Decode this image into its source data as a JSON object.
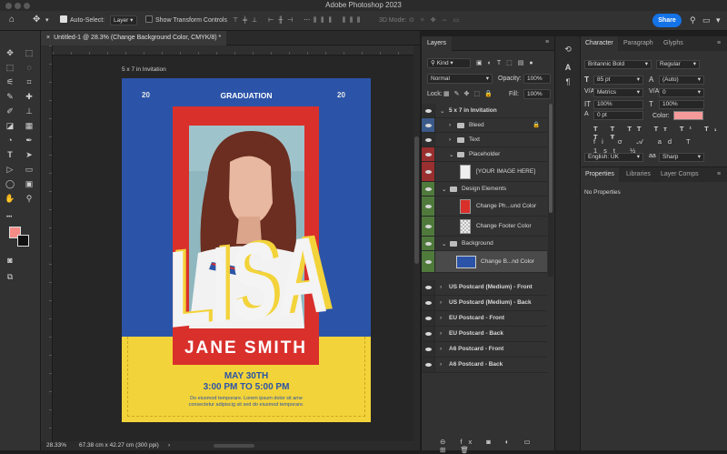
{
  "app_title": "Adobe Photoshop 2023",
  "options_bar": {
    "auto_select_label": "Auto-Select:",
    "auto_select_value": "Layer",
    "show_transform_label": "Show Transform Controls",
    "mode_3d_label": "3D Mode:",
    "share_label": "Share"
  },
  "document_tab": {
    "label": "Untitled-1 @ 28.3% (Change Background Color, CMYK/8) *"
  },
  "artboard_label": "5 x 7 in Invitation",
  "invitation": {
    "year_left": "20",
    "graduation": "GRADUATION",
    "year_right": "20",
    "big_name": "LISA",
    "full_name": "JANE SMITH",
    "date": "MAY 30TH",
    "time": "3:00 PM TO 5:00 PM",
    "body_line1": "Do eiusmod temporare. Lorem ipsum dolor sit ame",
    "body_line2": "consectetur adipiscig sit sed do eiusmod temporare."
  },
  "status_bar": {
    "zoom": "28.33%",
    "doc_info": "67.38 cm x 42.27 cm (300 ppi)"
  },
  "layers_panel": {
    "title": "Layers",
    "kind_label": "Kind",
    "blend_mode": "Normal",
    "opacity_label": "Opacity:",
    "opacity_value": "100%",
    "lock_label": "Lock:",
    "fill_label": "Fill:",
    "fill_value": "100%",
    "rows": [
      {
        "name": "5 x 7 in Invitation"
      },
      {
        "name": "Bleed"
      },
      {
        "name": "Text"
      },
      {
        "name": "Placeholder"
      },
      {
        "name": "[YOUR IMAGE HERE]"
      },
      {
        "name": "Design Elements"
      },
      {
        "name": "Change Ph...und Color"
      },
      {
        "name": "Change Footer Color"
      },
      {
        "name": "Background"
      },
      {
        "name": "Change B...nd Color"
      },
      {
        "name": "US Postcard (Medium) - Front"
      },
      {
        "name": "US Postcard (Medium) - Back"
      },
      {
        "name": "EU Postcard - Front"
      },
      {
        "name": "EU Postcard - Back"
      },
      {
        "name": "A6 Postcard - Front"
      },
      {
        "name": "A6 Postcard - Back"
      }
    ]
  },
  "character_panel": {
    "tabs": [
      "Character",
      "Paragraph",
      "Glyphs"
    ],
    "font_family": "Britannic Bold",
    "font_style": "Regular",
    "font_size": "85 pt",
    "leading": "(Auto)",
    "kerning": "Metrics",
    "tracking": "0",
    "vertical_scale": "100%",
    "horizontal_scale": "100%",
    "baseline_shift": "0 pt",
    "color_label": "Color:",
    "text_color": "#f59a9a",
    "language": "English: UK",
    "antialias": "Sharp"
  },
  "properties_panel": {
    "tabs": [
      "Properties",
      "Libraries",
      "Layer Comps"
    ],
    "empty_text": "No Properties"
  },
  "colors": {
    "share_button": "#1473e6",
    "invite_blue": "#2b54a8",
    "invite_red": "#d9302c",
    "invite_yellow": "#f3d33a",
    "foreground_swatch": "#f48b86"
  }
}
